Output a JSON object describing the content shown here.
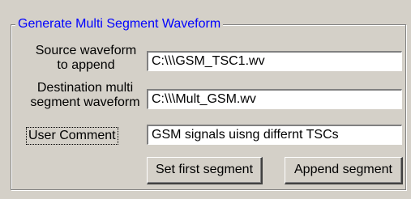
{
  "group": {
    "title": "Generate Multi Segment Waveform"
  },
  "fields": {
    "source": {
      "label_line1": "Source waveform",
      "label_line2": "to append",
      "value": "C:\\\\\\GSM_TSC1.wv"
    },
    "destination": {
      "label_line1": "Destination multi",
      "label_line2": "segment waveform",
      "value": "C:\\\\\\Mult_GSM.wv"
    },
    "comment": {
      "label": "User Comment",
      "value": "GSM signals uisng differnt TSCs"
    }
  },
  "buttons": {
    "set_first": "Set first segment",
    "append": "Append segment"
  },
  "colors": {
    "background": "#d4d0c8",
    "group_title": "#0000ff"
  }
}
